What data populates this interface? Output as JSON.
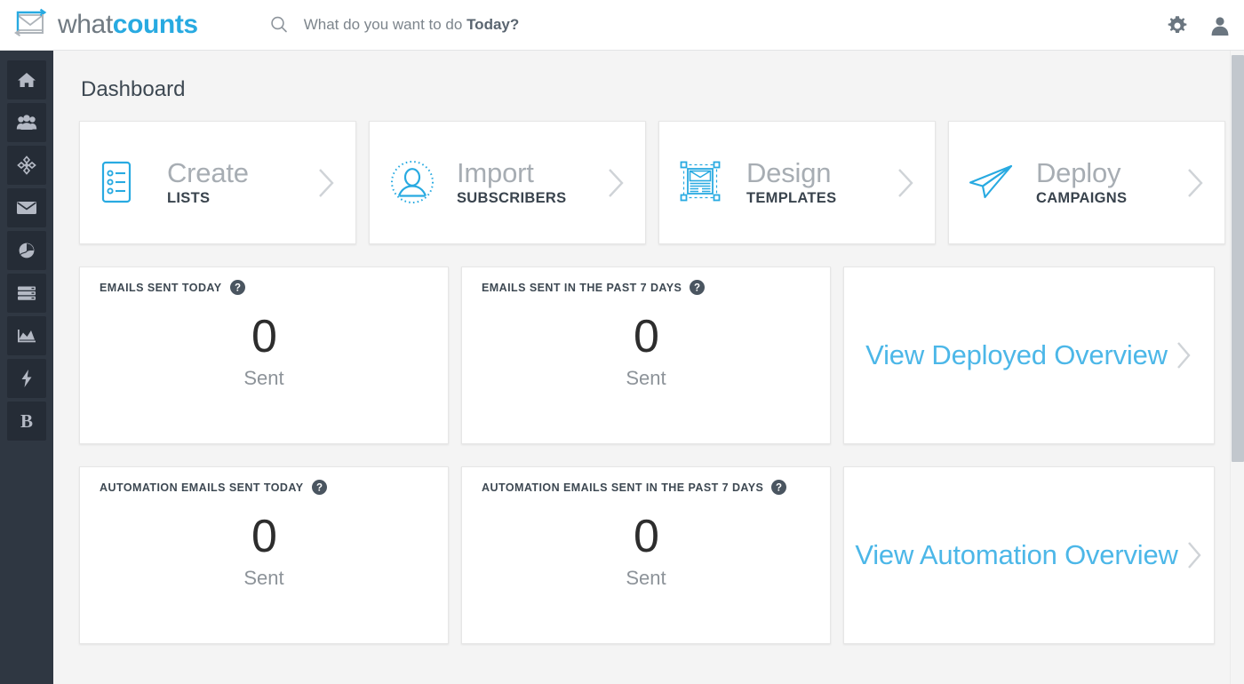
{
  "brand": {
    "logo_icon": "envelope-sync-icon",
    "name_part1": "what",
    "name_part2": "counts",
    "accent_color": "#28aae1",
    "muted_color": "#707a82"
  },
  "search": {
    "icon": "search-icon",
    "placeholder_prefix": "What do you want to do ",
    "placeholder_strong": "Today?"
  },
  "topbar_actions": [
    {
      "name": "settings",
      "icon": "gear-icon"
    },
    {
      "name": "account",
      "icon": "user-icon"
    }
  ],
  "sidebar": {
    "items": [
      {
        "name": "home",
        "icon": "home-icon"
      },
      {
        "name": "audience",
        "icon": "users-group-icon"
      },
      {
        "name": "targeting",
        "icon": "crosshair-icon"
      },
      {
        "name": "messages",
        "icon": "envelope-icon"
      },
      {
        "name": "reports",
        "icon": "globe-pie-icon"
      },
      {
        "name": "data",
        "icon": "server-stack-icon"
      },
      {
        "name": "analytics",
        "icon": "area-chart-icon"
      },
      {
        "name": "automation",
        "icon": "lightning-bolt-icon"
      },
      {
        "name": "brand",
        "icon": "letter-b-icon",
        "letter": "B"
      }
    ]
  },
  "main": {
    "page_title": "Dashboard",
    "action_cards": [
      {
        "icon": "checklist-icon",
        "title": "Create",
        "subtitle": "LISTS",
        "chevron": "chevron-right-icon"
      },
      {
        "icon": "user-circle-icon",
        "title": "Import",
        "subtitle": "SUBSCRIBERS",
        "chevron": "chevron-right-icon"
      },
      {
        "icon": "template-icon",
        "title": "Design",
        "subtitle": "TEMPLATES",
        "chevron": "chevron-right-icon"
      },
      {
        "icon": "paper-plane-icon",
        "title": "Deploy",
        "subtitle": "CAMPAIGNS",
        "chevron": "chevron-right-icon"
      }
    ],
    "metric_rows": [
      {
        "metrics": [
          {
            "label": "EMAILS SENT TODAY",
            "help": "help-icon",
            "value": "0",
            "unit": "Sent"
          },
          {
            "label": "EMAILS SENT IN THE PAST 7 DAYS",
            "help": "help-icon",
            "value": "0",
            "unit": "Sent"
          }
        ],
        "link": {
          "text": "View Deployed Overview",
          "chevron": "chevron-right-icon"
        }
      },
      {
        "metrics": [
          {
            "label": "AUTOMATION EMAILS SENT TODAY",
            "help": "help-icon",
            "value": "0",
            "unit": "Sent"
          },
          {
            "label": "AUTOMATION EMAILS SENT IN THE PAST 7 DAYS",
            "help": "help-icon",
            "value": "0",
            "unit": "Sent"
          }
        ],
        "link": {
          "text": "View Automation Overview",
          "chevron": "chevron-right-icon"
        }
      }
    ]
  },
  "scrollbar": {
    "name": "vertical-scrollbar"
  }
}
